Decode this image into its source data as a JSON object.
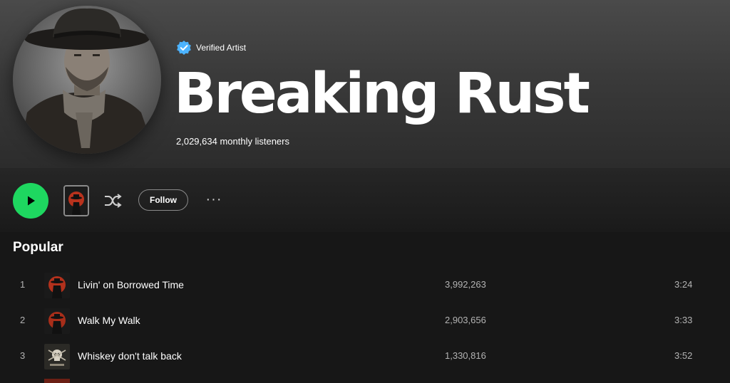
{
  "artist": {
    "verified_label": "Verified Artist",
    "name": "Breaking Rust",
    "monthly_listeners": "2,029,634 monthly listeners"
  },
  "actions": {
    "follow_label": "Follow",
    "more_label": "···"
  },
  "popular": {
    "title": "Popular",
    "tracks": [
      {
        "num": "1",
        "title": "Livin' on Borrowed Time",
        "plays": "3,992,263",
        "duration": "3:24",
        "art": "red-cowboy-cover"
      },
      {
        "num": "2",
        "title": "Walk My Walk",
        "plays": "2,903,656",
        "duration": "3:33",
        "art": "red-cowboy-cover"
      },
      {
        "num": "3",
        "title": "Whiskey don't talk back",
        "plays": "1,330,816",
        "duration": "3:52",
        "art": "skull-cover"
      }
    ]
  },
  "colors": {
    "play_button": "#1ed760",
    "verified_badge": "#4cb3ff",
    "background": "#121212",
    "secondary_text": "#b3b3b3"
  },
  "icons": {
    "play": "play-icon",
    "shuffle": "shuffle-icon",
    "verified": "verified-badge-icon",
    "more": "more-options-icon"
  }
}
